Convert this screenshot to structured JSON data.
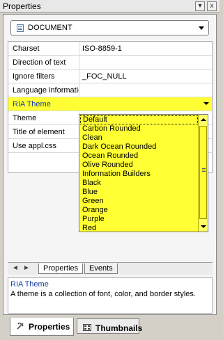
{
  "window": {
    "title": "Properties",
    "dropdown_btn": "▾",
    "close_btn": "x"
  },
  "object_selector": {
    "value": "DOCUMENT",
    "icon": "document-icon"
  },
  "properties": [
    {
      "name": "Charset",
      "value": "ISO-8859-1"
    },
    {
      "name": "Direction of text",
      "value": ""
    },
    {
      "name": "Ignore filters",
      "value": "_FOC_NULL"
    },
    {
      "name": "Language information",
      "value": ""
    },
    {
      "name": "RIA Theme",
      "value": ""
    },
    {
      "name": "Theme",
      "value": ""
    },
    {
      "name": "Title of element",
      "value": ""
    },
    {
      "name": "Use appl.css",
      "value": ""
    }
  ],
  "theme_dropdown": {
    "options": [
      "Default",
      "Carbon Rounded",
      "Clean",
      "Dark Ocean Rounded",
      "Ocean Rounded",
      "Olive Rounded",
      "Information Builders",
      "Black",
      "Blue",
      "Green",
      "Orange",
      "Purple",
      "Red"
    ],
    "selected": "Default"
  },
  "sheet_tabs": {
    "properties": "Properties",
    "events": "Events"
  },
  "description": {
    "title": "RIA Theme",
    "text": "A theme is a collection of font, color, and border styles."
  },
  "bottom_tabs": {
    "properties": "Properties",
    "thumbnails": "Thumbnails"
  },
  "colors": {
    "highlight": "#ffff33",
    "link_blue": "#1a3ea0"
  }
}
